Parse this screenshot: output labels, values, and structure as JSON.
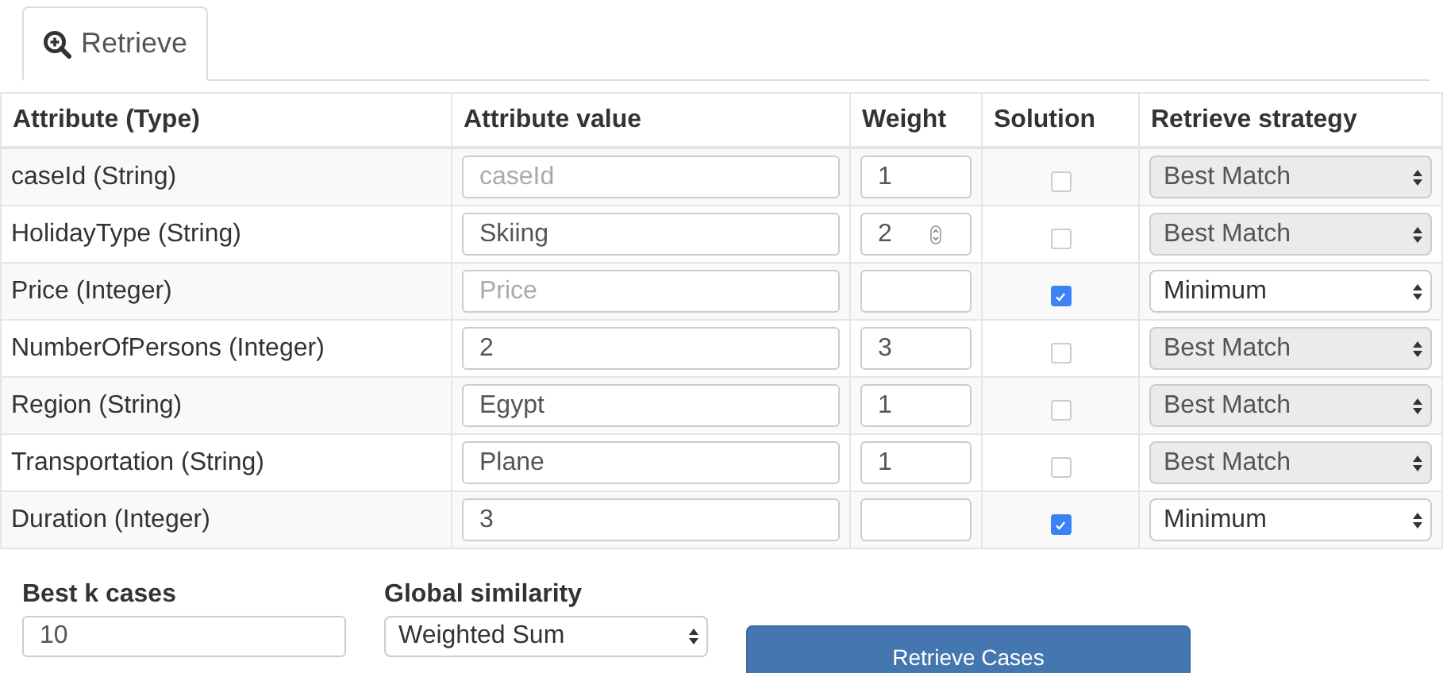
{
  "tabs": [
    {
      "label": "Retrieve",
      "selected": true
    }
  ],
  "table": {
    "columns": [
      "Attribute (Type)",
      "Attribute value",
      "Weight",
      "Solution",
      "Retrieve strategy"
    ],
    "rows": [
      {
        "attribute": "caseId (String)",
        "value": {
          "placeholder": "caseId"
        },
        "weight": {
          "value": "1",
          "stepper_shown": false
        },
        "solution": false,
        "strategy": {
          "value": "Best Match",
          "disabled": true
        }
      },
      {
        "attribute": "HolidayType (String)",
        "value": {
          "value": "Skiing"
        },
        "weight": {
          "value": "2",
          "stepper_shown": true
        },
        "solution": false,
        "strategy": {
          "value": "Best Match",
          "disabled": true
        }
      },
      {
        "attribute": "Price (Integer)",
        "value": {
          "placeholder": "Price"
        },
        "weight": {
          "stepper_shown": false
        },
        "solution": true,
        "strategy": {
          "value": "Minimum",
          "disabled": false
        }
      },
      {
        "attribute": "NumberOfPersons (Integer)",
        "value": {
          "value": "2"
        },
        "weight": {
          "value": "3",
          "stepper_shown": false
        },
        "solution": false,
        "strategy": {
          "value": "Best Match",
          "disabled": true
        }
      },
      {
        "attribute": "Region (String)",
        "value": {
          "value": "Egypt"
        },
        "weight": {
          "value": "1",
          "stepper_shown": false
        },
        "solution": false,
        "strategy": {
          "value": "Best Match",
          "disabled": true
        }
      },
      {
        "attribute": "Transportation (String)",
        "value": {
          "value": "Plane"
        },
        "weight": {
          "value": "1",
          "stepper_shown": false
        },
        "solution": false,
        "strategy": {
          "value": "Best Match",
          "disabled": true
        }
      },
      {
        "attribute": "Duration (Integer)",
        "value": {
          "value": "3"
        },
        "weight": {
          "stepper_shown": false
        },
        "solution": true,
        "strategy": {
          "value": "Minimum",
          "disabled": false
        }
      }
    ]
  },
  "best_k": {
    "label": "Best k cases",
    "value": "10"
  },
  "global_similarity": {
    "label": "Global similarity",
    "value": "Weighted Sum"
  },
  "retrieve_button": "Retrieve Cases"
}
